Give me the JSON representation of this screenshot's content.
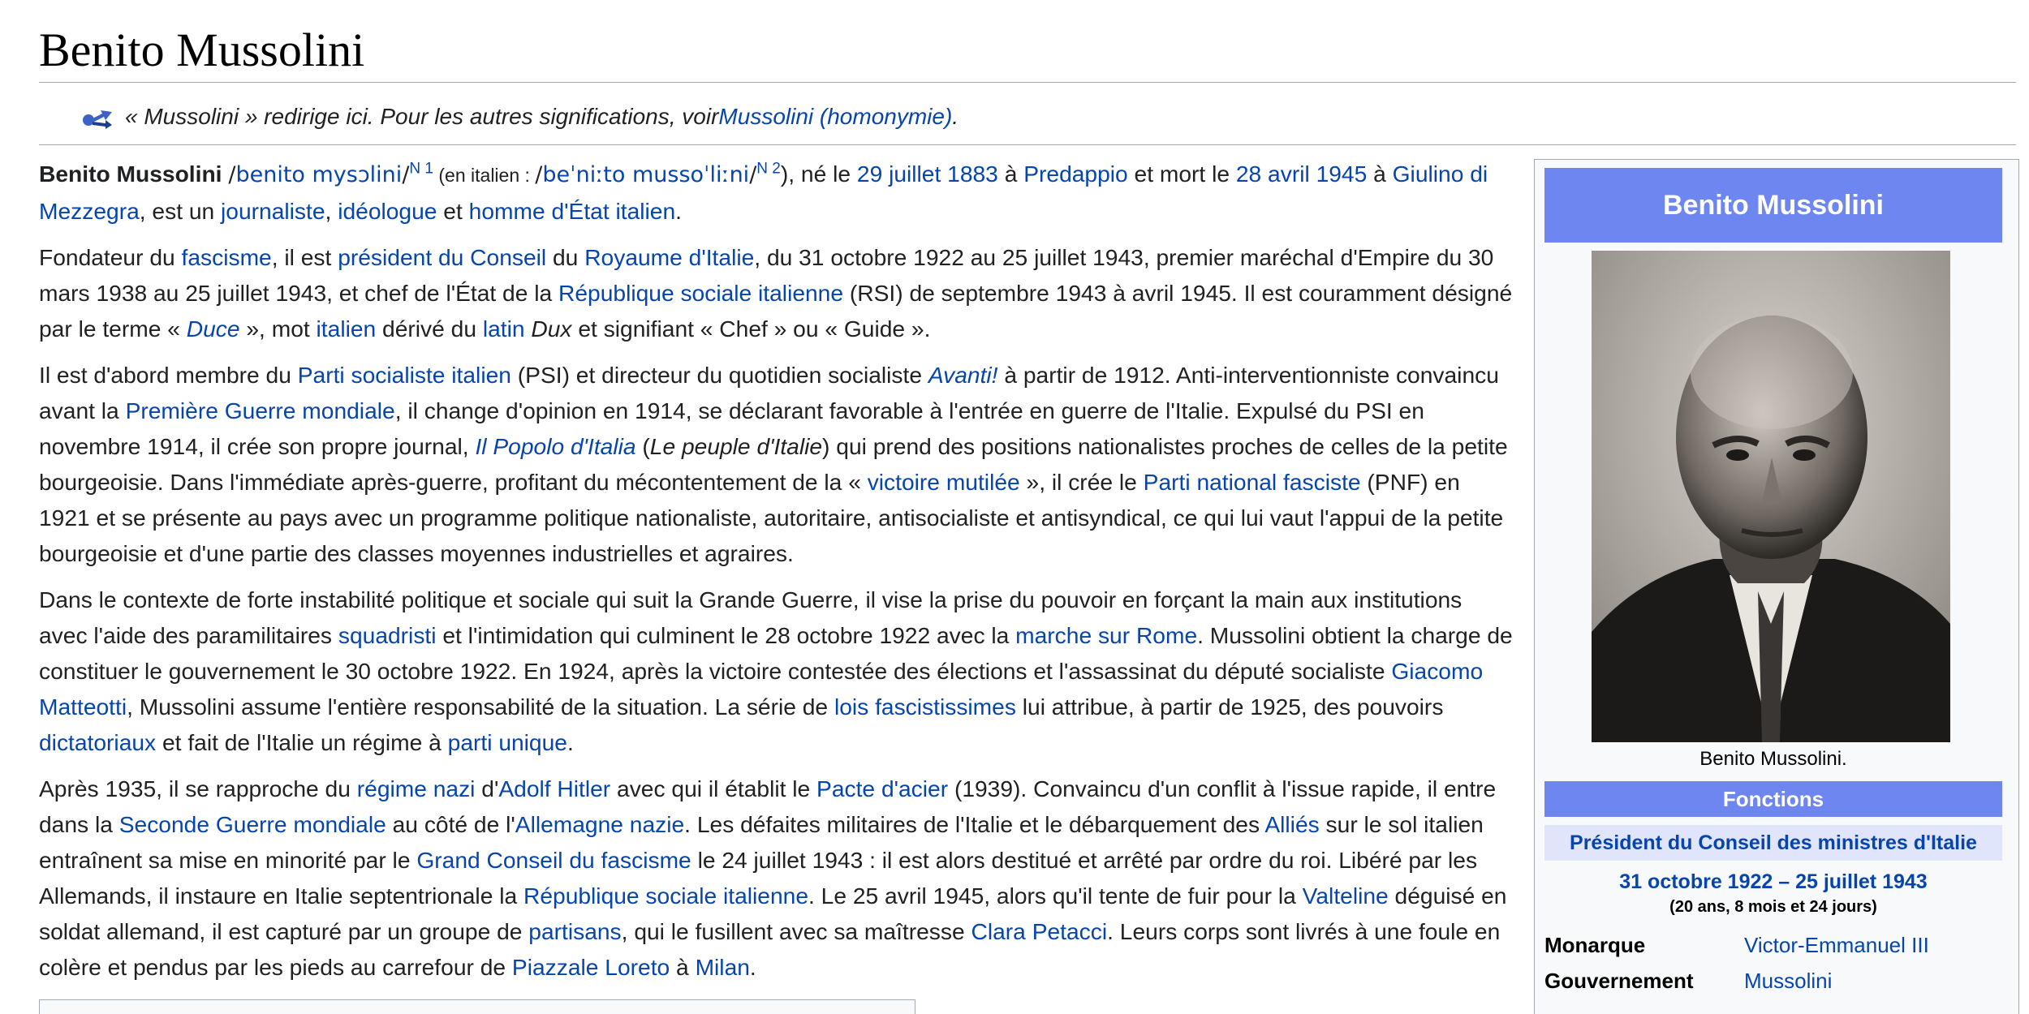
{
  "title": "Benito Mussolini",
  "hatnote": {
    "text": "« Mussolini » redirige ici. Pour les autres significations, voir ",
    "link": "Mussolini (homonymie)",
    "end": "."
  },
  "intro": {
    "name": "Benito Mussolini",
    "ipa1_pre": "/",
    "ipa1_link": "benito mysɔlini",
    "ipa1_post": "/",
    "note1": "N 1",
    "paren_open": " (en italien : ",
    "ipa2_pre": "/",
    "ipa2_link": "beˈniːto mussoˈliːni",
    "ipa2_post": "/",
    "note2": "N 2",
    "s1": "), né le ",
    "birth_date": "29 juillet 1883",
    "s2": " à ",
    "birth_place": "Predappio",
    "s3": " et mort le ",
    "death_date": "28 avril 1945",
    "s4": " à ",
    "death_place": "Giulino di Mezzegra",
    "s5": ", est un ",
    "l_journaliste": "journaliste",
    "s6": ", ",
    "l_ideologue": "idéologue",
    "s7": " et ",
    "l_homme": "homme d'État italien",
    "s8": "."
  },
  "p2": {
    "s1": "Fondateur du ",
    "l_fascisme": "fascisme",
    "s2": ", il est ",
    "l_president": "président du Conseil",
    "s3": " du ",
    "l_royaume": "Royaume d'Italie",
    "s4": ", du 31 octobre 1922 au 25 juillet 1943, premier maréchal d'Empire du 30 mars 1938 au 25 juillet 1943, et chef de l'État de la ",
    "l_rsi": "République sociale italienne",
    "s5": " (RSI) de septembre 1943 à avril 1945. Il est couramment désigné par le terme « ",
    "l_duce": "Duce",
    "s6": " », mot ",
    "l_italien": "italien",
    "s7": " dérivé du ",
    "l_latin": "latin",
    "s8": " ",
    "dux": "Dux",
    "s9": " et signifiant « Chef » ou « Guide »."
  },
  "p3": {
    "s1": "Il est d'abord membre du ",
    "l_psi": "Parti socialiste italien",
    "s2": " (PSI) et directeur du quotidien socialiste ",
    "l_avanti": "Avanti!",
    "s3": " à partir de 1912. Anti-interventionniste convaincu avant la ",
    "l_pgm": "Première Guerre mondiale",
    "s4": ", il change d'opinion en 1914, se déclarant favorable à l'entrée en guerre de l'Italie. Expulsé du PSI en novembre 1914, il crée son propre journal, ",
    "l_popolo": "Il Popolo d'Italia",
    "s5": " (",
    "peuple": "Le peuple d'Italie",
    "s6": ") qui prend des positions nationalistes proches de celles de la petite bourgeoisie. Dans l'immédiate après-guerre, profitant du mécontentement de la « ",
    "l_victoire": "victoire mutilée",
    "s7": " », il crée le ",
    "l_pnf": "Parti national fasciste",
    "s8": " (PNF) en 1921 et se présente au pays avec un programme politique nationaliste, autoritaire, antisocialiste et antisyndical, ce qui lui vaut l'appui de la petite bourgeoisie et d'une partie des classes moyennes industrielles et agraires."
  },
  "p4": {
    "s1": "Dans le contexte de forte instabilité politique et sociale qui suit la Grande Guerre, il vise la prise du pouvoir en forçant la main aux institutions avec l'aide des paramilitaires ",
    "l_squadristi": "squadristi",
    "s2": " et l'intimidation qui culminent le 28 octobre 1922 avec la ",
    "l_marche": "marche sur Rome",
    "s3": ". Mussolini obtient la charge de constituer le gouvernement le 30 octobre 1922. En 1924, après la victoire contestée des élections et l'assassinat du député socialiste ",
    "l_matteotti": "Giacomo Matteotti",
    "s4": ", Mussolini assume l'entière responsabilité de la situation. La série de ",
    "l_lois": "lois fascistissimes",
    "s5": " lui attribue, à partir de 1925, des pouvoirs ",
    "l_dictatoriaux": "dictatoriaux",
    "s6": " et fait de l'Italie un régime à ",
    "l_parti": "parti unique",
    "s7": "."
  },
  "p5": {
    "s1": "Après 1935, il se rapproche du ",
    "l_nazi": "régime nazi",
    "s2": " d'",
    "l_hitler": "Adolf Hitler",
    "s3": " avec qui il établit le ",
    "l_pacte": "Pacte d'acier",
    "s4": " (1939). Convaincu d'un conflit à l'issue rapide, il entre dans la ",
    "l_sgm": "Seconde Guerre mondiale",
    "s5": " au côté de l'",
    "l_allemagne": "Allemagne nazie",
    "s6": ". Les défaites militaires de l'Italie et le débarquement des ",
    "l_allies": "Alliés",
    "s7": " sur le sol italien entraînent sa mise en minorité par le ",
    "l_grand": "Grand Conseil du fascisme",
    "s8": " le 24 juillet 1943 : il est alors destitué et arrêté par ordre du roi. Libéré par les Allemands, il instaure en Italie septentrionale la ",
    "l_rsi": "République sociale italienne",
    "s9": ". Le 25 avril 1945, alors qu'il tente de fuir pour la ",
    "l_valteline": "Valteline",
    "s10": " déguisé en soldat allemand, il est capturé par un groupe de ",
    "l_partisans": "partisans",
    "s11": ", qui le fusillent avec sa maîtresse ",
    "l_petacci": "Clara Petacci",
    "s12": ". Leurs corps sont livrés à une foule en colère et pendus par les pieds au carrefour de ",
    "l_loreto": "Piazzale Loreto",
    "s13": " à ",
    "l_milan": "Milan",
    "s14": "."
  },
  "infobox": {
    "title": "Benito Mussolini",
    "caption": "Benito Mussolini.",
    "functions": "Fonctions",
    "office": "Président du Conseil des ministres d'Italie",
    "dates": "31 octobre 1922 – 25 juillet 1943",
    "duration": "(20 ans, 8 mois et 24 jours)",
    "rows": [
      {
        "key": "Monarque",
        "value": "Victor-Emmanuel III"
      },
      {
        "key": "Gouvernement",
        "value": "Mussolini"
      }
    ]
  },
  "colors": {
    "link": "#0645ad",
    "infobox_header": "#6e87f0",
    "infobox_office": "#e0e5fb",
    "border": "#a2a9b1"
  }
}
